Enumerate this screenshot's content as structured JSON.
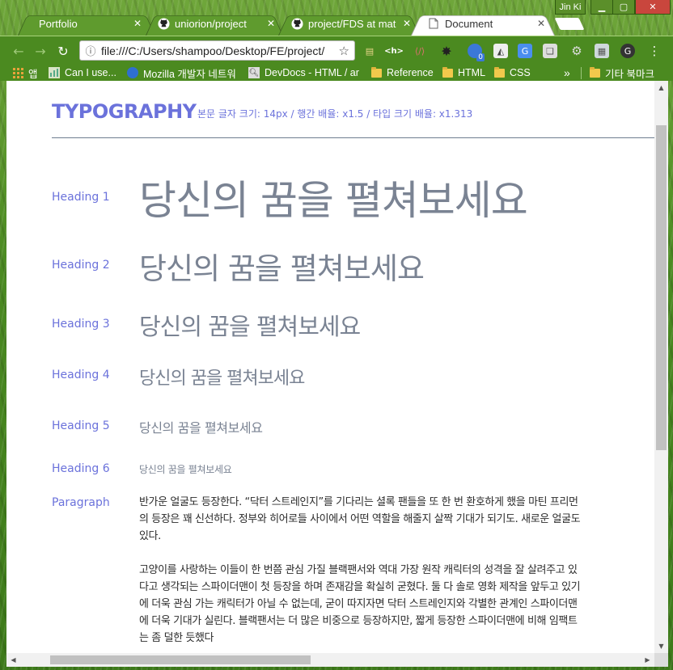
{
  "browser": {
    "tabs": [
      {
        "label": "Portfolio",
        "icon": "none",
        "active": false
      },
      {
        "label": "uniorion/project",
        "icon": "github-icon",
        "active": false
      },
      {
        "label": "project/FDS at mat",
        "icon": "github-icon",
        "active": false
      },
      {
        "label": "Document",
        "icon": "document-icon",
        "active": true
      }
    ],
    "user_name": "Jin Ki",
    "address": "file:///C:/Users/shampoo/Desktop/FE/project/",
    "extension_badge": "0",
    "bookmarks": [
      {
        "label": "앱",
        "icon": "apps-icon"
      },
      {
        "label": "Can I use...",
        "icon": "caniuse-icon"
      },
      {
        "label": "Mozilla 개발자 네트워",
        "icon": "mozilla-icon"
      },
      {
        "label": "DevDocs - HTML / ar",
        "icon": "devdocs-icon"
      },
      {
        "label": "Reference",
        "icon": "folder-icon"
      },
      {
        "label": "HTML",
        "icon": "folder-icon"
      },
      {
        "label": "CSS",
        "icon": "folder-icon"
      }
    ],
    "bookmarks_overflow": "»",
    "other_bookmarks": "기타 북마크"
  },
  "page": {
    "title": "TYPOGRAPHY",
    "meta": "본문 글자 크기: 14px / 행간 배율: x1.5 / 타입 크기 배율: x1.313",
    "rows": [
      {
        "label": "Heading 1",
        "sample": "당신의 꿈을 펼쳐보세요"
      },
      {
        "label": "Heading 2",
        "sample": "당신의 꿈을 펼쳐보세요"
      },
      {
        "label": "Heading 3",
        "sample": "당신의 꿈을 펼쳐보세요"
      },
      {
        "label": "Heading 4",
        "sample": "당신의 꿈을 펼쳐보세요"
      },
      {
        "label": "Heading 5",
        "sample": "당신의 꿈을 펼쳐보세요"
      },
      {
        "label": "Heading 6",
        "sample": "당신의 꿈을 펼쳐보세요"
      }
    ],
    "paragraph_label": "Paragraph",
    "paragraphs": [
      "반가운 얼굴도 등장한다. “닥터 스트레인지”를 기다리는 셜록 팬들을 또 한 번 환호하게 했을 마틴 프리먼의 등장은 꽤 신선하다. 정부와 히어로들 사이에서 어떤 역할을 해줄지 살짝 기대가 되기도. 새로운 얼굴도 있다.",
      "고양이를 사랑하는 이들이 한 번쯤 관심 가질 블랙팬서와 역대 가장 원작 캐릭터의 성격을 잘 살려주고 있다고 생각되는 스파이더맨이 첫 등장을 하며 존재감을 확실히 굳혔다. 둘 다 솔로 영화 제작을 앞두고 있기에 더욱 관심 가는 캐릭터가 아닐 수 없는데, 굳이 따지자면 닥터 스트레인지와 각별한 관계인 스파이더맨에 더욱 기대가 실린다. 블랙팬서는 더 많은 비중으로 등장하지만, 짧게 등장한 스파이더맨에 비해 임팩트는 좀 덜한 듯했다"
    ]
  }
}
